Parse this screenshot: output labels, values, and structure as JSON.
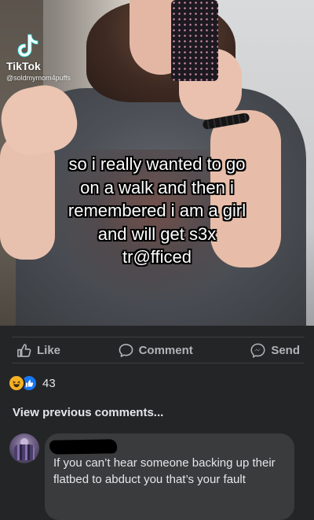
{
  "video": {
    "watermark_brand": "TikTok",
    "watermark_handle": "@soldmymom4puffs",
    "caption": "so i really wanted to go\non a walk and then i\nremembered i am a girl\nand will get s3x\ntr@fficed"
  },
  "actions": {
    "like_label": "Like",
    "comment_label": "Comment",
    "send_label": "Send"
  },
  "reactions": {
    "icons": [
      "haha-icon",
      "like-icon"
    ],
    "count": "43"
  },
  "comments": {
    "view_previous_label": "View previous comments...",
    "items": [
      {
        "author": "",
        "text": "If you can’t hear someone backing up their flatbed to abduct you that’s your fault"
      }
    ]
  },
  "colors": {
    "background": "#242526",
    "text_secondary": "#b0b3b8",
    "text_primary": "#e4e6eb",
    "bubble": "#3a3b3c",
    "like_blue": "#1877f2",
    "haha_yellow": "#f7b125"
  }
}
